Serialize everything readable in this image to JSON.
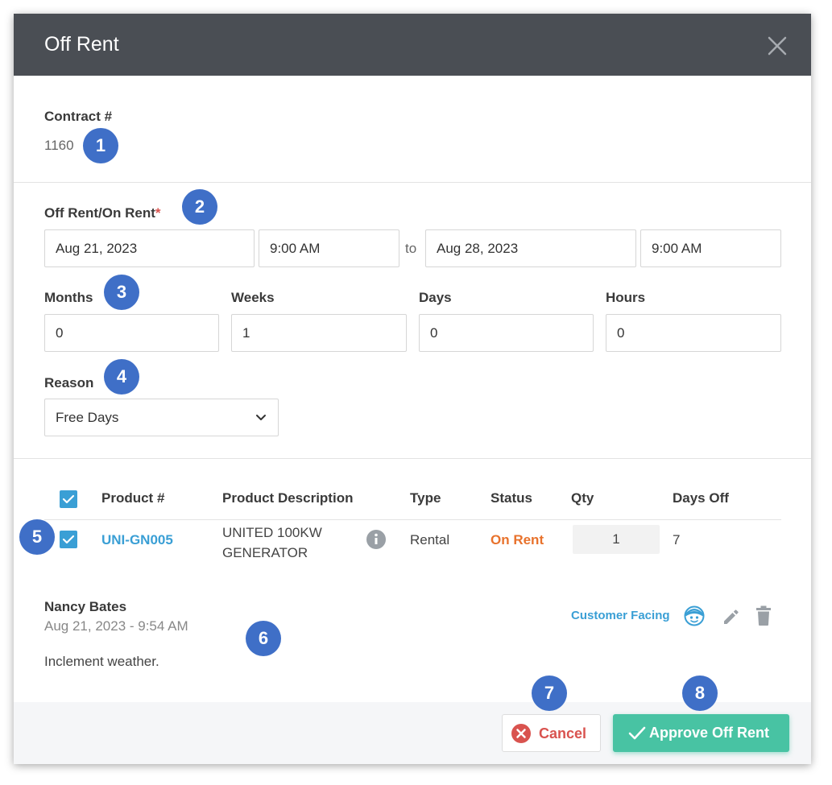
{
  "dialog": {
    "title": "Off Rent"
  },
  "contract": {
    "label": "Contract #",
    "value": "1160"
  },
  "period": {
    "label": "Off Rent/On Rent",
    "required_mark": "*",
    "start_date": "Aug 21, 2023",
    "start_time": "9:00 AM",
    "to_label": "to",
    "end_date": "Aug 28, 2023",
    "end_time": "9:00 AM"
  },
  "duration": {
    "months_label": "Months",
    "months": "0",
    "weeks_label": "Weeks",
    "weeks": "1",
    "days_label": "Days",
    "days": "0",
    "hours_label": "Hours",
    "hours": "0"
  },
  "reason": {
    "label": "Reason",
    "value": "Free Days"
  },
  "table": {
    "headers": [
      "Product #",
      "Product Description",
      "Type",
      "Status",
      "Qty",
      "Days Off"
    ],
    "rows": [
      {
        "product": "UNI-GN005",
        "description_line1": "UNITED 100KW",
        "description_line2": "GENERATOR",
        "type": "Rental",
        "status": "On Rent",
        "qty": "1",
        "days_off": "7"
      }
    ]
  },
  "note": {
    "author": "Nancy Bates",
    "date": "Aug 21, 2023 - 9:54 AM",
    "body": "Inclement weather.",
    "visibility": "Customer Facing"
  },
  "footer": {
    "cancel_label": "Cancel",
    "approve_label": "Approve Off Rent"
  },
  "callouts": [
    "1",
    "2",
    "3",
    "4",
    "5",
    "6",
    "7",
    "8"
  ],
  "colors": {
    "header_bg": "#4a4e54",
    "accent": "#3a9fd5",
    "status_on_rent": "#e8722c",
    "cancel": "#d9534f",
    "approve": "#48c3a3",
    "callout": "#3f6fc7"
  },
  "icons": [
    "close-icon",
    "chevron-down-icon",
    "checkbox-icon",
    "info-icon",
    "customer-face-icon",
    "pencil-icon",
    "trash-icon",
    "cancel-x-icon",
    "checkmark-icon"
  ]
}
